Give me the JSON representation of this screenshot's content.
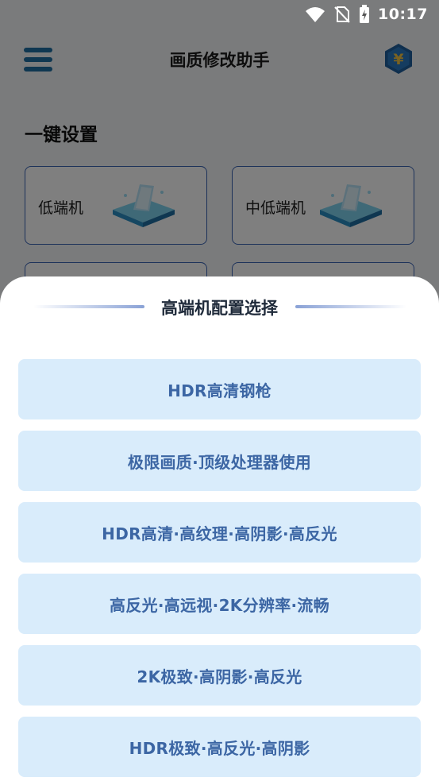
{
  "status_bar": {
    "time": "10:17"
  },
  "header": {
    "title": "画质修改助手",
    "coin_symbol": "¥"
  },
  "section": {
    "title": "一键设置"
  },
  "devices": [
    {
      "label": "低端机"
    },
    {
      "label": "中低端机"
    }
  ],
  "sheet": {
    "title": "高端机配置选择",
    "options": [
      {
        "label": "HDR高清钢枪"
      },
      {
        "label": "极限画质·顶级处理器使用"
      },
      {
        "label": "HDR高清·高纹理·高阴影·高反光"
      },
      {
        "label": "高反光·高远视·2K分辨率·流畅"
      },
      {
        "label": "2K极致·高阴影·高反光"
      },
      {
        "label": "HDR极致·高反光·高阴影"
      }
    ]
  },
  "colors": {
    "accent": "#3a64b5",
    "option_bg": "#d9ecfb",
    "option_text": "#3c66a4",
    "menu_icon": "#1f6fa3"
  }
}
